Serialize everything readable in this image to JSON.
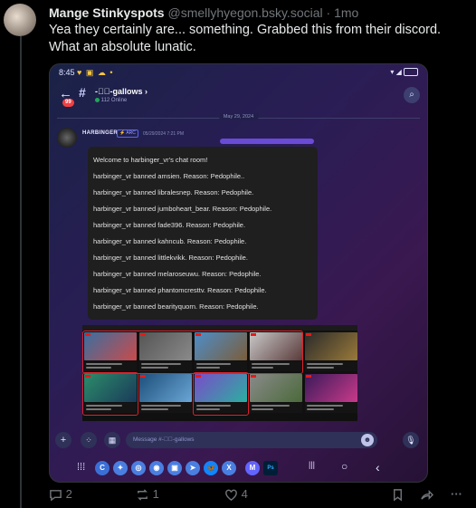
{
  "post": {
    "display_name": "Mange Stinkyspots",
    "handle": "@smellyhyegon.bsky.social",
    "separator": "·",
    "time": "1mo",
    "text_line1": "Yea they certainly are... something. Grabbed this from their discord.",
    "text_line2": "What an absolute lunatic."
  },
  "phone": {
    "status_time": "8:45",
    "status_icons": "♥ ▣ ☁ •",
    "header": {
      "back_icon": "arrow-left-icon",
      "unread_badge": "99",
      "channel_name": "-᭄᷼-gallows ›",
      "online_text": "112 Online",
      "search_icon": "search-icon"
    },
    "date_separator": "May 29, 2024",
    "message": {
      "author": "HARBINGER",
      "role_tag": "⚡ ARC",
      "timestamp": "05/29/2024 7:21 PM"
    },
    "chat_box": {
      "lines": [
        "Welcome to harbinger_vr's chat room!",
        "harbinger_vr banned amsien. Reason: Pedophile..",
        "harbinger_vr banned libralesnep. Reason: Pedophile.",
        "harbinger_vr banned jumboheart_bear. Reason: Pedophile.",
        "harbinger_vr banned fade396. Reason: Pedophile.",
        "harbinger_vr banned kahncub. Reason: Pedophile.",
        "harbinger_vr banned littlekvikk. Reason: Pedophile.",
        "harbinger_vr banned melaroseuwu. Reason: Pedophile.",
        "harbinger_vr banned phantomcresttv. Reason: Pedophile.",
        "harbinger_vr banned bearityquorn. Reason: Pedophile."
      ]
    },
    "input": {
      "placeholder": "Message #-᭄᷼-gallows",
      "add_icon": "plus-icon",
      "apps_icon": "apps-icon",
      "gift_icon": "gift-icon",
      "emoji_icon": "emoji-icon",
      "mic_icon": "microphone-icon"
    },
    "nav": {
      "apps": [
        "C",
        "✦",
        "◎",
        "◉",
        "▣",
        "➤",
        "🦋",
        "X",
        "M",
        "Ps"
      ],
      "buttons": [
        "|||",
        "○",
        "‹"
      ]
    },
    "accent_color": "#5865f2",
    "highlight_color": "#e0202a"
  },
  "actions": {
    "replies": "2",
    "reposts": "1",
    "likes": "4"
  },
  "colors": {
    "background": "#000000",
    "text_primary": "#e7e9ea",
    "text_secondary": "#71767b"
  }
}
